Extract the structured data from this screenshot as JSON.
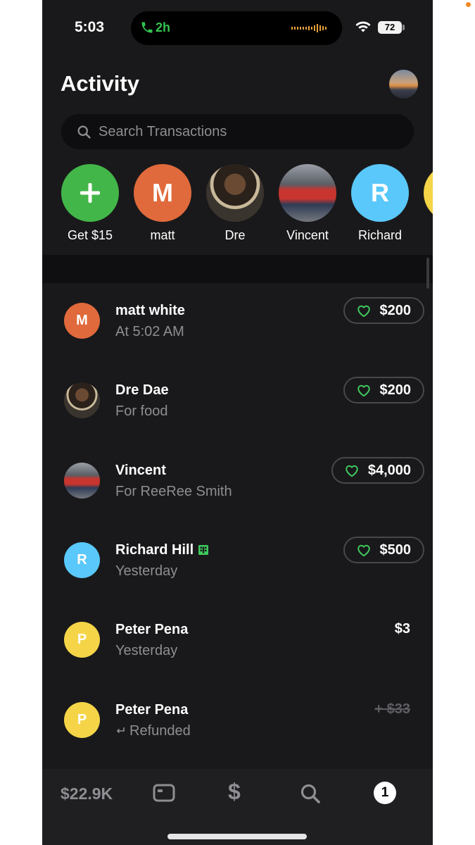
{
  "status_bar": {
    "time": "5:03",
    "call_duration": "2h",
    "battery": "72"
  },
  "header": {
    "title": "Activity"
  },
  "search": {
    "placeholder": "Search Transactions"
  },
  "contacts": [
    {
      "label": "Get $15",
      "initial": "",
      "icon": "plus-icon",
      "color": "#43b649"
    },
    {
      "label": "matt",
      "initial": "M",
      "color": "#e06a3b"
    },
    {
      "label": "Dre",
      "initial": "",
      "icon": "photo",
      "color": "#3a3128"
    },
    {
      "label": "Vincent",
      "initial": "",
      "icon": "photo",
      "color": "#6d6f75"
    },
    {
      "label": "Richard",
      "initial": "R",
      "color": "#5ac8fa"
    }
  ],
  "transactions": [
    {
      "name": "matt white",
      "subtitle": "At 5:02 AM",
      "amount": "$200",
      "liked": true,
      "initial": "M",
      "color": "#e06a3b"
    },
    {
      "name": "Dre Dae",
      "subtitle": "For food",
      "amount": "$200",
      "liked": true,
      "initial": "",
      "color": "#3a3128"
    },
    {
      "name": "Vincent",
      "subtitle": "For ReeRee Smith",
      "amount": "$4,000",
      "liked": true,
      "initial": "",
      "color": "#6d6f75"
    },
    {
      "name": "Richard Hill",
      "subtitle": "Yesterday",
      "amount": "$500",
      "liked": true,
      "initial": "R",
      "color": "#5ac8fa",
      "business": true
    },
    {
      "name": "Peter Pena",
      "subtitle": "Yesterday",
      "amount": "$3",
      "liked": false,
      "initial": "P",
      "color": "#f5d547"
    },
    {
      "name": "Peter Pena",
      "subtitle": "Refunded",
      "amount": "+ $33",
      "liked": false,
      "initial": "P",
      "color": "#f5d547",
      "refunded": true
    }
  ],
  "bottom_nav": {
    "balance": "$22.9K",
    "dollar_glyph": "$",
    "activity_badge": "1"
  },
  "colors": {
    "background": "#19191b",
    "accent_green": "#43b649",
    "heart_green": "#3ec95c",
    "text_secondary": "#8e8e93"
  }
}
